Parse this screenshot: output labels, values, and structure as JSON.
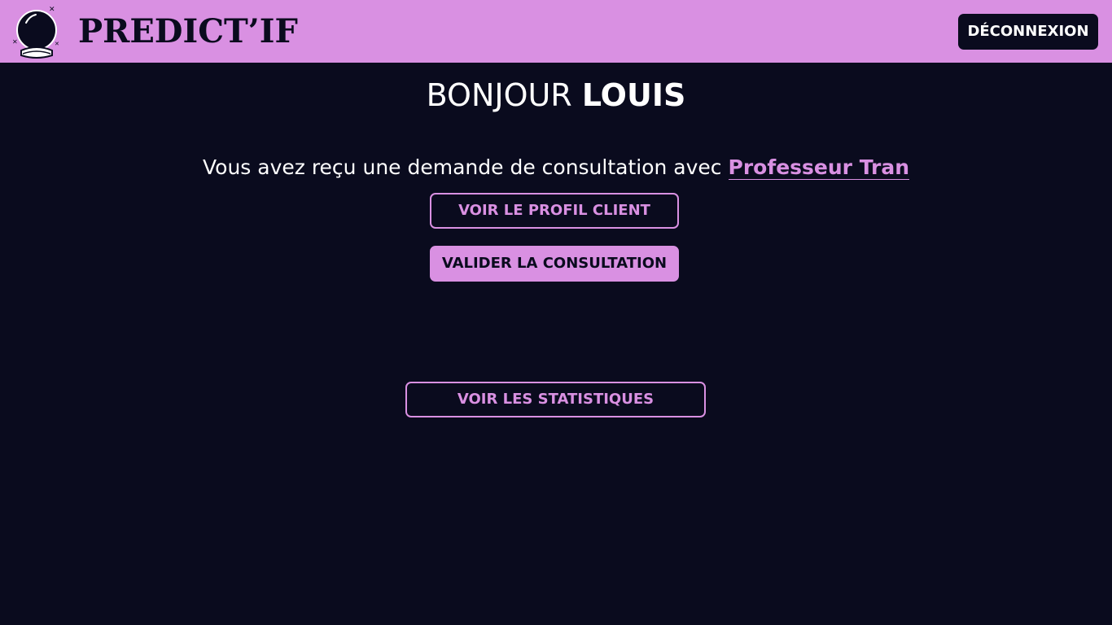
{
  "header": {
    "brand": "PREDICT’IF",
    "logo_icon": "crystal-ball-icon",
    "logout_label": "DÉCONNEXION"
  },
  "main": {
    "greeting_prefix": "BONJOUR",
    "user_name": "LOUIS",
    "message_text": "Vous avez reçu une demande de consultation avec",
    "medium_name": "Professeur Tran",
    "view_profile_label": "VOIR LE PROFIL CLIENT",
    "validate_label": "VALIDER LA CONSULTATION",
    "stats_label": "VOIR LES STATISTIQUES"
  },
  "colors": {
    "background": "#0a0b1e",
    "accent": "#d990e2",
    "text": "#ffffff"
  }
}
